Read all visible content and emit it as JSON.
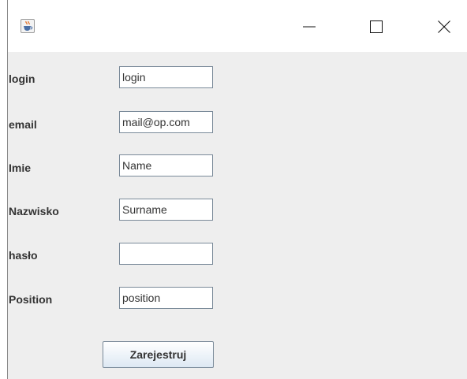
{
  "titlebar": {
    "icon": "java-coffee-icon",
    "buttons": {
      "minimize": "minimize-icon",
      "maximize": "maximize-icon",
      "close": "close-icon"
    }
  },
  "form": {
    "fields": [
      {
        "label": "login",
        "value": "login"
      },
      {
        "label": "email",
        "value": "mail@op.com"
      },
      {
        "label": "Imie",
        "value": "Name"
      },
      {
        "label": "Nazwisko",
        "value": "Surname"
      },
      {
        "label": "hasło",
        "value": ""
      },
      {
        "label": "Position",
        "value": "position"
      }
    ],
    "submit_label": "Zarejestruj"
  },
  "colors": {
    "content_background": "#eeeeee",
    "titlebar_background": "#ffffff",
    "label_text": "#333333",
    "input_border": "#7a8a99"
  }
}
